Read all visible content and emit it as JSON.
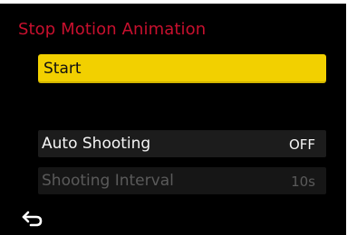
{
  "menu": {
    "title": "Stop Motion Animation",
    "start_label": "Start",
    "items": [
      {
        "label": "Auto Shooting",
        "value": "OFF",
        "enabled": true
      },
      {
        "label": "Shooting Interval",
        "value": "10s",
        "enabled": false
      }
    ]
  },
  "footer": {
    "back_icon": "return-arrow-icon"
  },
  "colors": {
    "title": "#c8102e",
    "highlight": "#f2d000",
    "background": "#000000",
    "disabled_text": "#5a5a5a"
  }
}
